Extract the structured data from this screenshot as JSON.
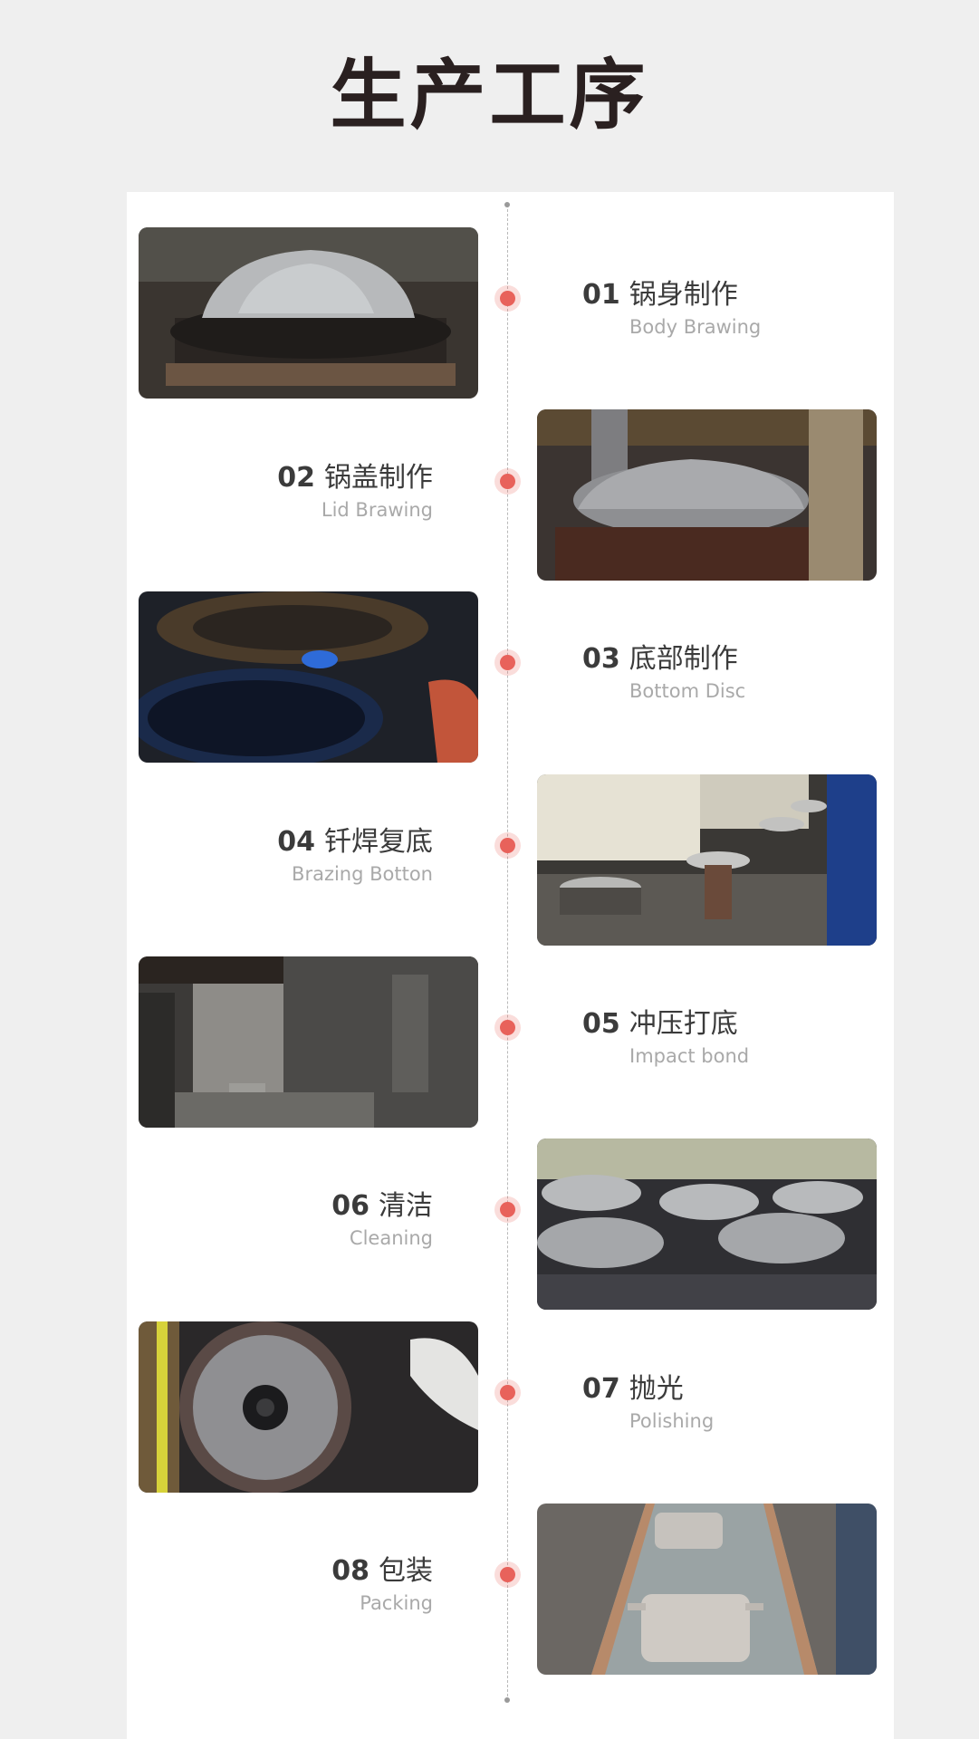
{
  "page_title": "生产工序",
  "steps": [
    {
      "num": "01",
      "cn": "锅身制作",
      "en": "Body Brawing"
    },
    {
      "num": "02",
      "cn": "锅盖制作",
      "en": "Lid Brawing"
    },
    {
      "num": "03",
      "cn": "底部制作",
      "en": "Bottom Disc"
    },
    {
      "num": "04",
      "cn": "钎焊复底",
      "en": "Brazing Botton"
    },
    {
      "num": "05",
      "cn": "冲压打底",
      "en": "Impact bond"
    },
    {
      "num": "06",
      "cn": "清洁",
      "en": "Cleaning"
    },
    {
      "num": "07",
      "cn": "抛光",
      "en": "Polishing"
    },
    {
      "num": "08",
      "cn": "包装",
      "en": "Packing"
    }
  ],
  "colors": {
    "accent_dot": "#e8625b",
    "background": "#efefef",
    "card": "#ffffff"
  }
}
